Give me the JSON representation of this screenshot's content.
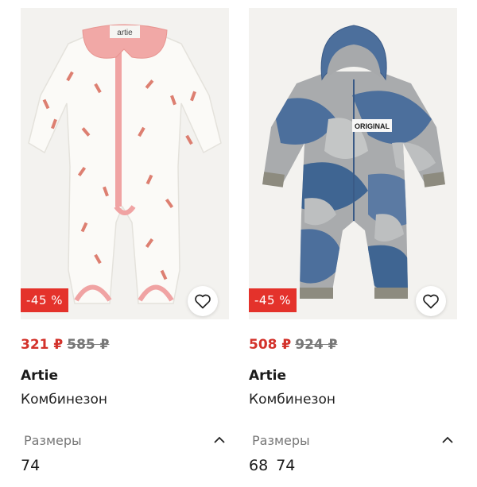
{
  "products": [
    {
      "discount": "-45 %",
      "price_new": "321 ₽",
      "price_old": "585 ₽",
      "brand": "Artie",
      "name": "Комбинезон",
      "sizes_label": "Размеры",
      "sizes": [
        "74"
      ],
      "collar_label": "artie",
      "favorite_icon": "heart-outline-icon",
      "toggle_icon": "chevron-up-icon"
    },
    {
      "discount": "-45 %",
      "price_new": "508 ₽",
      "price_old": "924 ₽",
      "brand": "Artie",
      "name": "Комбинезон",
      "sizes_label": "Размеры",
      "sizes": [
        "68",
        "74"
      ],
      "chest_label": "ORIGINAL",
      "favorite_icon": "heart-outline-icon",
      "toggle_icon": "chevron-up-icon"
    }
  ],
  "colors": {
    "discount_bg": "#e4322b",
    "price_new": "#d3322b",
    "price_old": "#777777"
  }
}
